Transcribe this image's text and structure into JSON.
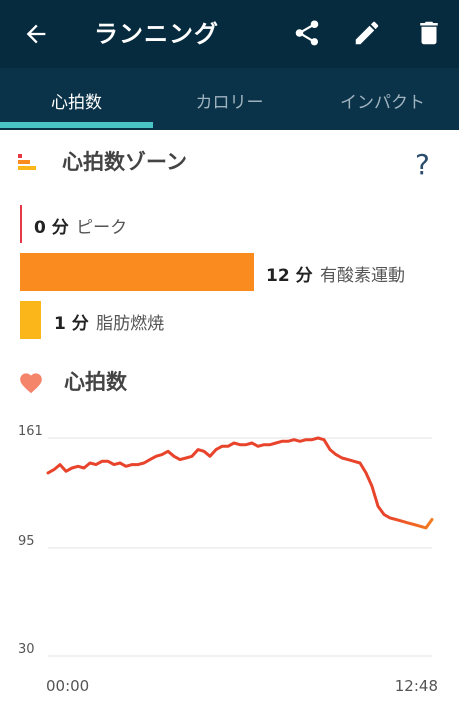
{
  "appbar": {
    "title": "ランニング",
    "icons": [
      "back-arrow-icon",
      "share-icon",
      "edit-pencil-icon",
      "trash-icon"
    ]
  },
  "tabs": [
    {
      "label": "心拍数",
      "active": true
    },
    {
      "label": "カロリー",
      "active": false
    },
    {
      "label": "インパクト",
      "active": false
    }
  ],
  "zones": {
    "title": "心拍数ゾーン",
    "help": "?",
    "items": [
      {
        "value": "0 分",
        "label": "ピーク",
        "color": "#e63946",
        "minutes": 0
      },
      {
        "value": "12 分",
        "label": "有酸素運動",
        "color": "#fa8c1f",
        "minutes": 12
      },
      {
        "value": "1 分",
        "label": "脂肪燃焼",
        "color": "#fbb61a",
        "minutes": 1
      }
    ]
  },
  "heart_rate": {
    "title": "心拍数"
  },
  "chart_data": {
    "type": "line",
    "title": "",
    "xlabel": "",
    "ylabel": "",
    "ylim": [
      30,
      161
    ],
    "yticks": [
      "161",
      "95",
      "30"
    ],
    "xticks": [
      "00:00",
      "12:48"
    ],
    "grid": true,
    "colors": {
      "line": "#e8432b",
      "line_end": "#f57c1f"
    },
    "series": [
      {
        "x": [
          0,
          0.2,
          0.4,
          0.6,
          0.8,
          1.0,
          1.2,
          1.4,
          1.6,
          1.8,
          2.0,
          2.2,
          2.4,
          2.6,
          2.8,
          3.0,
          3.2,
          3.4,
          3.6,
          3.8,
          4.0,
          4.2,
          4.4,
          4.6,
          4.8,
          5.0,
          5.2,
          5.4,
          5.6,
          5.8,
          6.0,
          6.2,
          6.4,
          6.6,
          6.8,
          7.0,
          7.2,
          7.4,
          7.6,
          7.8,
          8.0,
          8.2,
          8.4,
          8.6,
          8.8,
          9.0,
          9.2,
          9.4,
          9.6,
          9.8,
          10.0,
          10.2,
          10.4,
          10.6,
          10.8,
          11.0,
          11.2,
          11.4,
          11.6,
          11.8,
          12.0,
          12.2,
          12.4,
          12.6,
          12.8
        ],
        "values": [
          140,
          142,
          145,
          141,
          143,
          144,
          143,
          146,
          145,
          147,
          147,
          145,
          146,
          144,
          145,
          145,
          146,
          148,
          150,
          151,
          153,
          150,
          148,
          149,
          150,
          154,
          153,
          150,
          154,
          156,
          156,
          158,
          157,
          157,
          158,
          156,
          157,
          157,
          158,
          159,
          159,
          160,
          159,
          160,
          160,
          161,
          160,
          154,
          151,
          149,
          148,
          147,
          146,
          140,
          132,
          120,
          115,
          113,
          112,
          111,
          110,
          109,
          108,
          107,
          112
        ]
      }
    ]
  }
}
